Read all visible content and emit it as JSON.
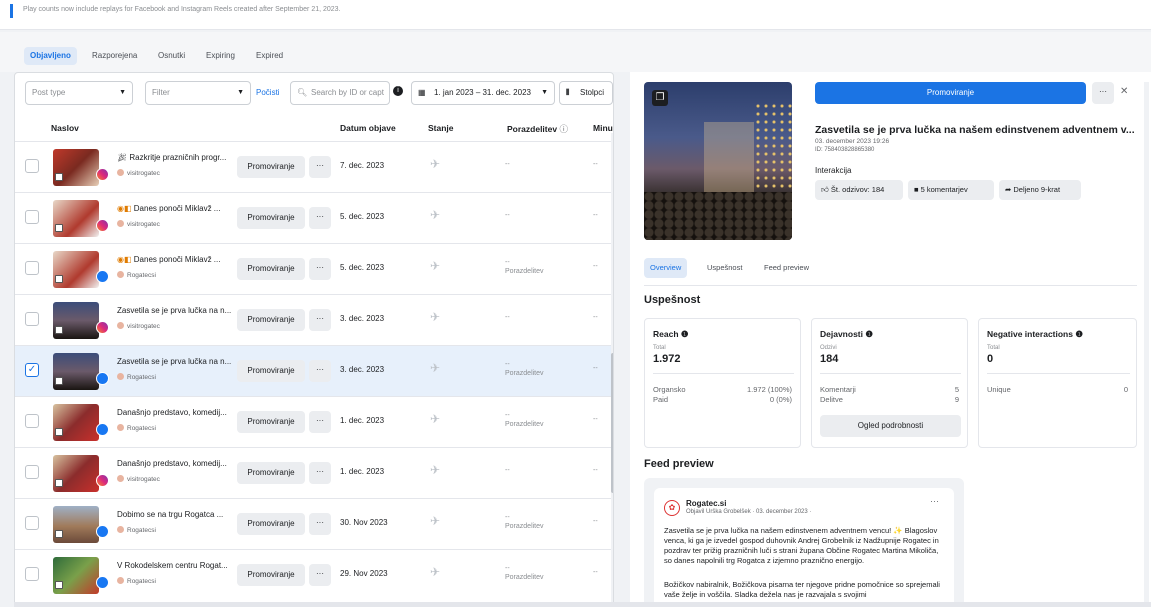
{
  "notice": "Play counts now include replays for Facebook and Instagram Reels created after September 21, 2023.",
  "tabs": [
    "Objavljeno",
    "Razporejena",
    "Osnutki",
    "Expiring",
    "Expired"
  ],
  "filters": {
    "post_type": "Post type",
    "filter": "Filter",
    "clear": "Počisti",
    "search_placeholder": "Search by ID or capt",
    "date_range": "1. jan 2023 – 31. dec. 2023",
    "columns": "Stolpci"
  },
  "columns": [
    "Naslov",
    "Datum objave",
    "Stanje",
    "Porazdelitev",
    "Minu"
  ],
  "rows": [
    {
      "title": "Razkritje prazničnih progr...",
      "account": "visitrogatec",
      "promote": "Promoviranje",
      "more": "···",
      "date": "7. dec. 2023",
      "dist": "--",
      "min": "--",
      "platform": "ig",
      "checked": false,
      "icon": "party-icon"
    },
    {
      "title": "Danes ponoči Miklavž ...",
      "account": "visitrogatec",
      "promote": "Promoviranje",
      "more": "···",
      "date": "5. dec. 2023",
      "dist": "--",
      "min": "--",
      "platform": "ig",
      "checked": false,
      "icon": "gift-icon"
    },
    {
      "title": "Danes ponoči Miklavž ...",
      "account": "Rogatecsi",
      "promote": "Promoviranje",
      "more": "···",
      "date": "5. dec. 2023",
      "dist": "--",
      "dist_label": "Porazdelitev",
      "min": "--",
      "platform": "fb",
      "checked": false,
      "icon": "gift-icon"
    },
    {
      "title": "Zasvetila se je prva lučka na n...",
      "account": "visitrogatec",
      "promote": "Promoviranje",
      "more": "···",
      "date": "3. dec. 2023",
      "dist": "--",
      "min": "--",
      "platform": "ig",
      "checked": false,
      "icon": ""
    },
    {
      "title": "Zasvetila se je prva lučka na n...",
      "account": "Rogatecsi",
      "promote": "Promoviranje",
      "more": "···",
      "date": "3. dec. 2023",
      "dist": "--",
      "dist_label": "Porazdelitev",
      "min": "--",
      "platform": "fb",
      "checked": true,
      "icon": ""
    },
    {
      "title": "Današnjo predstavo, komedij...",
      "account": "Rogatecsi",
      "promote": "Promoviranje",
      "more": "···",
      "date": "1. dec. 2023",
      "dist": "--",
      "dist_label": "Porazdelitev",
      "min": "--",
      "platform": "fb",
      "checked": false,
      "icon": ""
    },
    {
      "title": "Današnjo predstavo, komedij...",
      "account": "visitrogatec",
      "promote": "Promoviranje",
      "more": "···",
      "date": "1. dec. 2023",
      "dist": "--",
      "min": "--",
      "platform": "ig",
      "checked": false,
      "icon": ""
    },
    {
      "title": "Dobimo se na trgu Rogatca ...",
      "account": "Rogatecsi",
      "promote": "Promoviranje",
      "more": "···",
      "date": "30. Nov 2023",
      "dist": "--",
      "dist_label": "Porazdelitev",
      "min": "--",
      "platform": "fb",
      "checked": false,
      "icon": ""
    },
    {
      "title": "V Rokodelskem centru Rogat...",
      "account": "Rogatecsi",
      "promote": "Promoviranje",
      "more": "···",
      "date": "29. Nov 2023",
      "dist": "--",
      "dist_label": "Porazdelitev",
      "min": "--",
      "platform": "fb",
      "checked": false,
      "icon": ""
    }
  ],
  "detail": {
    "promote": "Promoviranje",
    "more": "···",
    "close": "✕",
    "title": "Zasvetila se je prva lučka na našem edinstvenem adventnem v...",
    "date": "03. december 2023 19:26",
    "id": "ID: 758403828865380",
    "interaction_label": "Interakcija",
    "reactions": "Št. odzivov: 184",
    "comments": "5 komentarjev",
    "shares": "Deljeno 9-krat",
    "subtabs": [
      "Overview",
      "Uspešnost",
      "Feed preview"
    ],
    "perf_title": "Uspešnost",
    "reach": {
      "title": "Reach",
      "total_label": "Total",
      "total": "1.972",
      "organic_label": "Organsko",
      "organic": "1.972 (100%)",
      "paid_label": "Paid",
      "paid": "0 (0%)"
    },
    "engagement": {
      "title": "Dejavnosti",
      "total_label": "Odzivi",
      "total": "184",
      "comments_label": "Komentarji",
      "comments": "5",
      "shares_label": "Delitve",
      "shares": "9",
      "details_btn": "Ogled podrobnosti"
    },
    "negative": {
      "title": "Negative interactions",
      "total_label": "Total",
      "total": "0",
      "unique_label": "Unique",
      "unique": "0"
    },
    "feed_title": "Feed preview",
    "feed": {
      "page": "Rogatec.si",
      "byline": "Objavil Urška Grobelšek · 03. december 2023 ·",
      "text": "Zasvetila se je prva lučka na našem edinstvenem adventnem vencu! ✨ Blagoslov venca, ki ga je izvedel gospod duhovnik Andrej Grobelnik iz Nadžupnije Rogatec in pozdrav ter prižig prazničnih luči s strani župana Občine Rogatec Martina Mikoliča, so danes napolnili trg Rogatca z izjemno praznično energijo.",
      "text2": "Božičkov nabiralnik, Božičkova pisarna ter njegove pridne pomočnice so sprejemali vaše želje in voščila. Sladka dežela nas je razvajala s svojimi"
    }
  }
}
